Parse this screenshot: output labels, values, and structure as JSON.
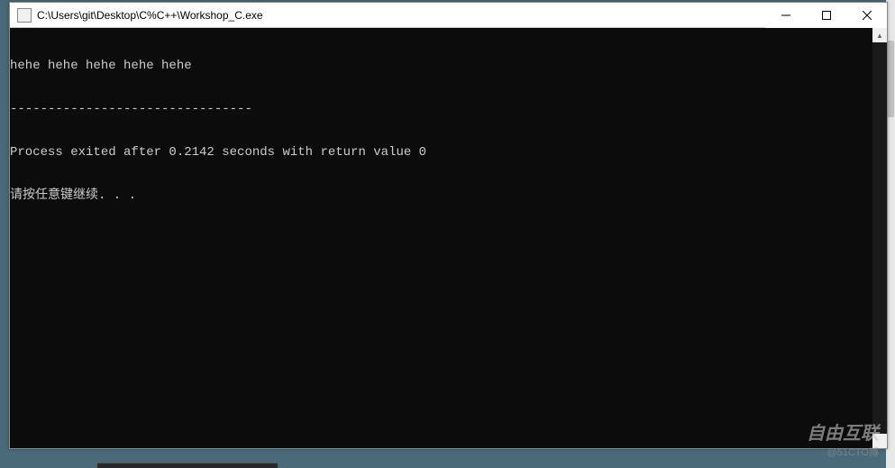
{
  "window": {
    "title": "C:\\Users\\git\\Desktop\\C%C++\\Workshop_C.exe"
  },
  "console": {
    "lines": [
      "hehe hehe hehe hehe hehe",
      "--------------------------------",
      "Process exited after 0.2142 seconds with return value 0",
      "请按任意键继续. . ."
    ]
  },
  "watermark": {
    "main": "自由互联",
    "sub": "@51CTO博"
  }
}
